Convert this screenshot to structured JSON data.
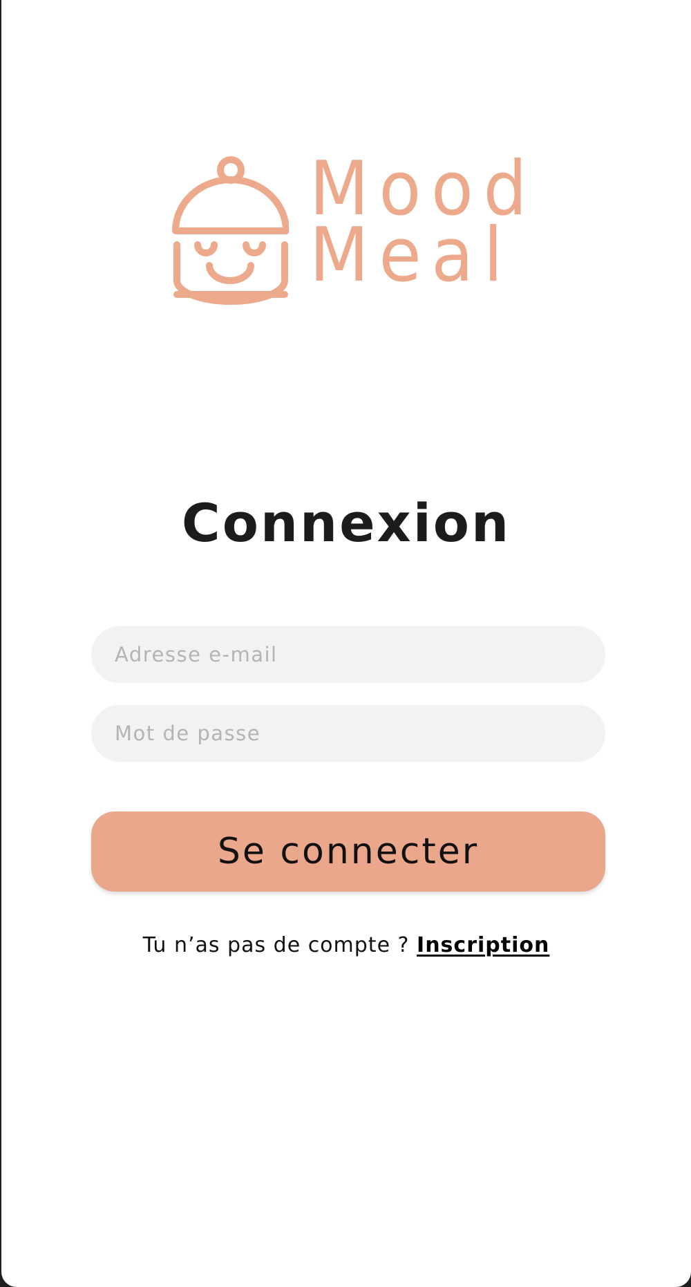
{
  "brand": {
    "name_line1": "Mood",
    "name_line2": "Meal",
    "logo_icon": "smiling-cloche-icon",
    "color": "#eda98c"
  },
  "login": {
    "title": "Connexion",
    "email_placeholder": "Adresse e-mail",
    "password_placeholder": "Mot de passe",
    "submit_label": "Se connecter",
    "signup_prompt": "Tu n’as pas de compte ?",
    "signup_link": "Inscription"
  },
  "colors": {
    "accent": "#eba78c",
    "field_background": "#f2f2f2",
    "text": "#1c1c1c"
  }
}
